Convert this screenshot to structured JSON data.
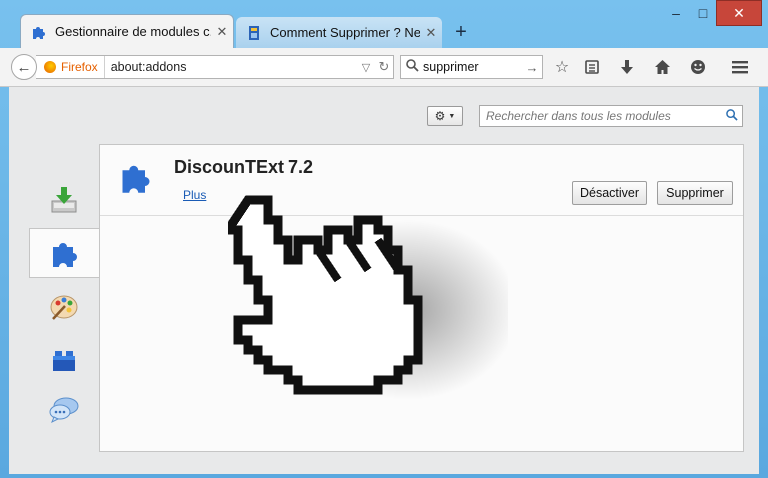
{
  "window": {
    "controls": {
      "minimize": "–",
      "maximize": "□",
      "close": "✕"
    }
  },
  "tabs": [
    {
      "label": "Gestionnaire de modules c...",
      "icon": "puzzle-icon",
      "close": "✕",
      "active": true
    },
    {
      "label": "Comment Supprimer ? Net...",
      "icon": "page-icon",
      "close": "✕",
      "active": false
    }
  ],
  "new_tab_label": "+",
  "toolbar": {
    "back": "←",
    "identity_label": "Firefox",
    "url": "about:addons",
    "search_value": "supprimer",
    "buttons": [
      "star-icon",
      "bookmarks-list-icon",
      "download-icon",
      "home-icon",
      "smiley-icon",
      "menu-icon"
    ]
  },
  "addons_manager": {
    "search_placeholder": "Rechercher dans tous les modules",
    "categories": [
      "get-addons-icon",
      "extensions-icon",
      "appearance-icon",
      "plugins-icon",
      "services-icon"
    ],
    "selected_category": "extensions-icon",
    "addon": {
      "name": "DiscounTExt",
      "version": "7.2",
      "more_link": "Plus",
      "disable_label": "Désactiver",
      "remove_label": "Supprimer"
    }
  },
  "colors": {
    "accent_link": "#1a5bb5",
    "frame": "#6fb7e6",
    "close_button": "#c7463a"
  }
}
